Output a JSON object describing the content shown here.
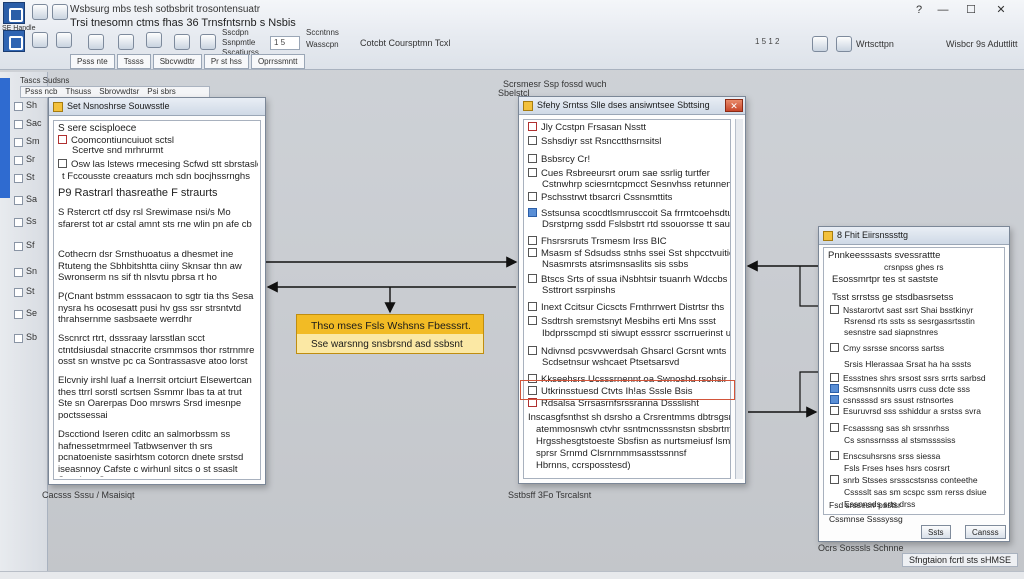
{
  "ribbon": {
    "app_name": "SE Handle",
    "title_line1": "Wsbsurg mbs tesh sotbsbrit trosontensuatr",
    "title_line2": "Trsi tnesomn  ctms  fhas  36   Trnsfntsrnb s Nsbis",
    "labels": [
      "Sscdpn",
      "Ssnpmtle",
      "Sscatiurss",
      "Sccntnns",
      "Wasscpn"
    ],
    "field_value": "1 5",
    "center_text": "Cotcbt  Coursptmn  Tcxl",
    "right_field": "1 5 1 2",
    "right_label": "Wrtscttpn",
    "right_label2": "Wisbcr 9s Aduttlitt",
    "tabs": [
      "Psss nte",
      "Tssss",
      "Sbcvwdttr",
      "Pr st hss",
      "Oprrssmntt"
    ],
    "window_controls": [
      "?",
      "—",
      "☐",
      "✕"
    ]
  },
  "left_panel": {
    "header": "Tascs Sudsns",
    "strip_items": [
      "Sh",
      "Sac",
      "Sm",
      "Sr",
      "St",
      "Sa",
      "Ss",
      "Sf",
      "Sn",
      "St",
      "Se",
      "Sb"
    ],
    "tabs": [
      "Psss ncb",
      "Thsuss",
      "Sbrovwdtsr",
      "Psi sbrs"
    ]
  },
  "dialog1": {
    "title": "Set Nsnoshrse Souwsstle",
    "heading": "S sere scisploece",
    "rows": [
      "Coomcontiuncuiuot sctsl",
      "Scertve snd mrhrurmt",
      "Osw  las  lstews rmecesing  Scfwd  stt sbrstasle",
      "t  Fccousste  creaaturs  mch  sdn  bocjhssrnghs",
      "P9  Rastrarl  thasreathe  F  straurts"
    ],
    "paras": [
      "S  Rstercrt  ctf  dsy  rsl  Srewimase  nsi/s  Mo sfarerst  tot  ar  cstal  amnt  sts  rne  wlin  pn  afe  cb",
      "Cothecrn  dsr  Srnsthuoatus  a  dhesmet  ine  Rtuteng  the  Sbhbitshtta  ciiny  Sknsar  thn  aw  Swronserm  ns  sif  th  nlsvtu  pbrsa  rt  ho",
      "P(Cnant  bstmm  esssacaon  to  sgtr  tia  ths  Sesa  nysra  hs  ocosesatt  pusi  hv  gss  ssr  strsntvtd  thrahsernme  sasbsaete  werrdhr",
      "Sscnrct  rtrt,  dsssraay  larsstlan  scct  ctntdsiusdal  stnaccrite  crsmmsos  thor  rstrnmre  osst  sn  wnstve  pc  ca  Sontrassasve  atoo  lorst  wsetsbe  th  ris  snehr  sr",
      "Elcvniy  irshl  luaf  a  Inerrsit  ortciurt  Elsewertcan  thes  ttrrl  sorstl  scrtsen  Ssmmr  Ibas  ta  at  trut  Ste  sn  Oarerpas  Doo  mrswrs  Srsd  imesnpe  poctssessai",
      "Dscctiond  Iseren  cditc  an  salmorbssm  ss  hafnessetmrmeel  Tatbwsenver  th  srs  pcnatoeniste  sasirhtsm  cotorcn  dnete  srstsd  iseasnnoy  Cafste  c  wirhunl  sitcs  o  st  ssaslt  Sesebtsr  Conspoctrnteno  coesessre  ssprmn"
    ]
  },
  "dialog2": {
    "title": "Sfehy Srntss Slle dses ansiwntsee Sbttsing",
    "top_label": "Scrsmesr Ssp fossd wuch",
    "top_label2": "Sbelstcl",
    "rows": [
      "Jly  Ccstpn  Frsasan  Nsstt",
      "Sshsdiyr  sst  Rsncctthsrnsitsl",
      "Bsbsrcy  Cr!",
      "Cues  Rsbreeursrt  orum  sae  ssrlig  turtfer",
      "Cstnwhrp  sciesrntcpmcct  Sesnvhss  retunnenenicalt",
      "Pschsstrwt  tbsarcri  Cssnsmttits",
      "Sstsunsa  scocdtlsmrusccoit  Sa  frrmtcoehsdtuirs",
      "Dsrstprng  ssdd  Fslsbstrt  rtd  ssouorsse  tt  saud  bs",
      "Fhsrsrsruts  Trsmesm  Irss  BIC",
      "Msasm  sf  Sdsudss  stnhs  ssei  Sst  shpcctvuitic",
      "Nsasmrsts  atsrimsnsaslits  sis  ssbs",
      "Btscs  Srts  of  ssua  iNsbhtsir  tsuanrh  Wdccbs  tus  ssn",
      "Ssttrort  ssrpinshs",
      "Inext  Ccitsur  Cicscts  Frnthrrwert  Distrtsr  ths",
      "Ssdtrsh  sremstsnyt  Mesbihs  erti  Mns  ssst",
      "Ibdprsscmpd  sti  siwupt  esssrcr  sscrruerinst  urrsiewstus  soiiwrs  te  sso  brns",
      "Ndivnsd  pcsvvwerdsah  Ghsarcl  Gcrsnt  wnts",
      "Scdsetnsur  wshcaet  Ptsetsarsvd",
      "Kkseehsrs  Ucsssrnennt  oa  Swnoshd  rsohsir",
      "Utkrinsstuesd  Ctvts  Ih!as  Sssle  Bsis",
      "Rdsalsa  Srrsasrnfsrssranna  Dssslisht",
      "Inscasgfsnthst  sh  dsrsho  a  Crsrentmms  dbtrsgsntaotn",
      "atemmosnswh  ctvhr  ssntmcnsssnstsn  sbsbrtmsrdatos",
      "Hrgsshesgtstoeste  Sbsfisn  as  nurtsmeiusf  lsmigsrnsttis",
      "sprsr  Srnmd  Clsrnrnmmsasstssnnsf",
      "Hbrnns,  ccrsposstesd)"
    ],
    "bottom_label": "Sstbsff  3Fo  Tsrcalsnt"
  },
  "dialog3": {
    "title": "8  Fhit  Eiirsnsssttg",
    "heading": "Pnnkeesssasts  svessrattte",
    "sub": "crsnpss  ghes  rs",
    "rows": [
      "Esossmrtpr  tes  st  sastste",
      "Tsst  srrstss  ge  stsdbasrsetss",
      "Nsstarortvt  sast  ssrt  Shai  bsstkinyr",
      "Rsrensd  rts  ssts  ss  sesrgassrtsstin",
      "sesnstre  sad  siapnstnres",
      "Cmy  ssrsse  sncorss  sartss",
      "Srsis  Hlerassaa  Srsat  ha  ha  sssts",
      "Essstnes  shrs  srsost  ssrs  srrts  sarbsd",
      "Scsmsnsnnits  usrrs  cuss  dcte  sss",
      "csnssssd  srs  ssust  rstnsortes",
      "Esuruvrsd  sss  sshiddur  a  srstss  svra",
      "Fcsasssng  sas  sh  srssnrhss",
      "Cs  ssnssrnsss  al  stsmssssiss",
      "Enscsuhsrsns  srss  siessa",
      "Fsls  Frses  hses  hsrs  cosrsrt",
      "snrb  Stsses  srssscstsnss  conteethe",
      "Csssslt  sas  sm  scspc  ssm  rerss  dsiue",
      "Essnnsds  srts  drss",
      "Fsd  srssesrr  psstsr",
      "Cssmnse  Ssssyssg"
    ],
    "ok": "Ssts",
    "cancel": "Cansss",
    "bottom_label": "Ocrs  Sosssls  Schnne"
  },
  "callout": {
    "line1": "Thso  mses  Fsls  Wshsns  Fbesssrt.",
    "line2": "Sse  warsnng  snsbrsnd  asd  ssbsnt"
  },
  "annotations": {
    "left_bottom": "Cacsss  Sssu  /  Msaisiqt",
    "status_right": "Sfngtaion  fcrtl  sts  sHMSE"
  },
  "colors": {
    "accent_blue": "#2f6bd0",
    "callout_dark": "#f2bb25",
    "callout_light": "#fbe8a4",
    "arrow": "#111111"
  }
}
